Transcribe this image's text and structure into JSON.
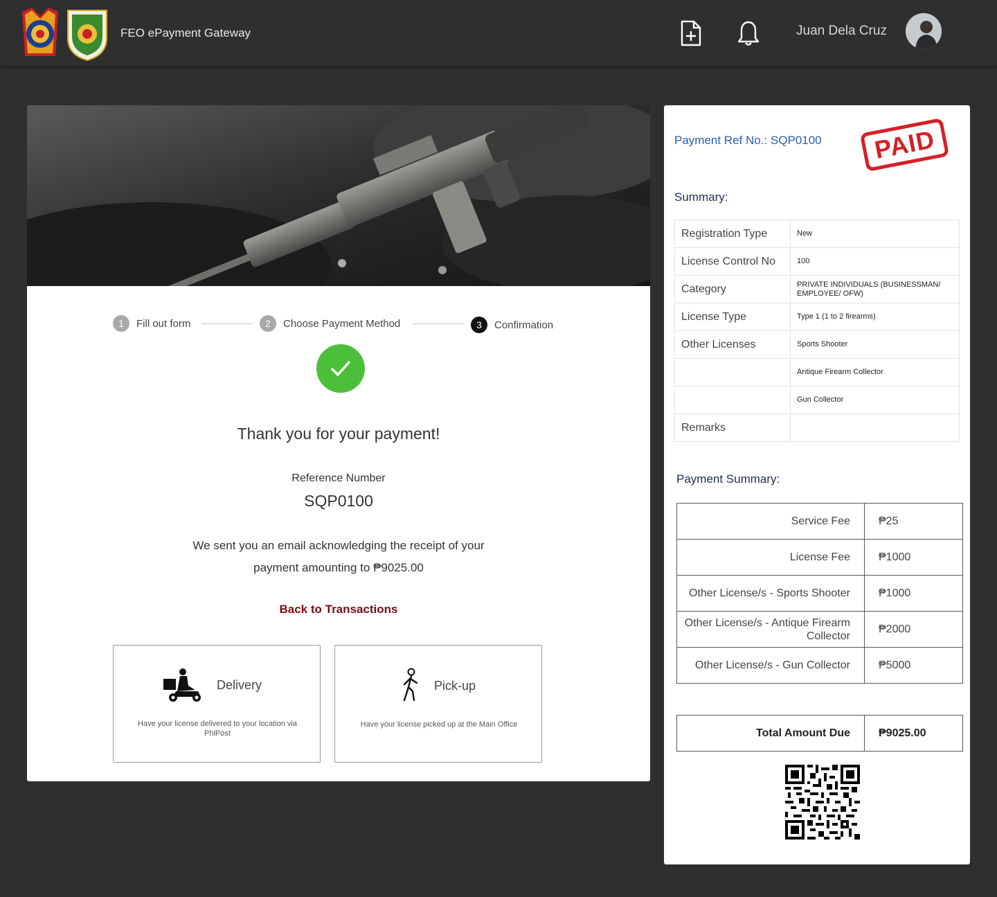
{
  "header": {
    "logos": [
      "pnp-seal",
      "fed-seal"
    ],
    "app_title": "FEO ePayment Gateway",
    "icons": [
      "new-document-icon",
      "bell-icon"
    ],
    "user_name": "Juan Dela Cruz"
  },
  "stepper": {
    "steps": [
      {
        "num": "1",
        "label": "Fill out form"
      },
      {
        "num": "2",
        "label": "Choose Payment Method"
      },
      {
        "num": "3",
        "label": "Confirmation"
      }
    ],
    "active": 3
  },
  "confirmation": {
    "thanks": "Thank you for your payment!",
    "ref_label": "Reference Number",
    "ref_number": "SQP0100",
    "email_line1": "We sent you an email acknowledging the receipt of your",
    "email_line2": "payment amounting to ₱9025.00",
    "back_link": "Back to Transactions",
    "success_color": "#4cbf3a",
    "link_color": "#7a0d1a"
  },
  "options": [
    {
      "title": "Delivery",
      "desc": "Have your license delivered to your location via PhlPost",
      "icon": "delivery-scooter-icon"
    },
    {
      "title": "Pick-up",
      "desc": "Have your license picked up at the Main Office",
      "icon": "walking-person-icon"
    }
  ],
  "summary": {
    "payment_ref": "Payment Ref No.: SQP0100",
    "stamp": "PAID",
    "title": "Summary:",
    "rows": [
      {
        "key": "Registration Type",
        "value": "New"
      },
      {
        "key": "License Control No",
        "value": "100"
      },
      {
        "key": "Category",
        "value": "PRIVATE INDIVIDUALS (BUSINESSMAN/ EMPLOYEE/ OFW)"
      },
      {
        "key": "License Type",
        "value": "Type 1 (1 to 2 firearms)"
      },
      {
        "key": "Other Licenses",
        "value": "Sports Shooter"
      },
      {
        "key": "",
        "value": "Antique Firearm Collector"
      },
      {
        "key": "",
        "value": "Gun Collector"
      },
      {
        "key": "Remarks",
        "value": ""
      }
    ]
  },
  "payment_summary": {
    "title": "Payment Summary:",
    "fees": [
      {
        "label": "Service Fee",
        "amount": "₱25"
      },
      {
        "label": "License Fee",
        "amount": "₱1000"
      },
      {
        "label": "Other License/s - Sports Shooter",
        "amount": "₱1000"
      },
      {
        "label": "Other License/s - Antique Firearm Collector",
        "amount": "₱2000"
      },
      {
        "label": "Other License/s - Gun Collector",
        "amount": "₱5000"
      }
    ],
    "total_label": "Total Amount Due",
    "total_amount": "₱9025.00"
  }
}
